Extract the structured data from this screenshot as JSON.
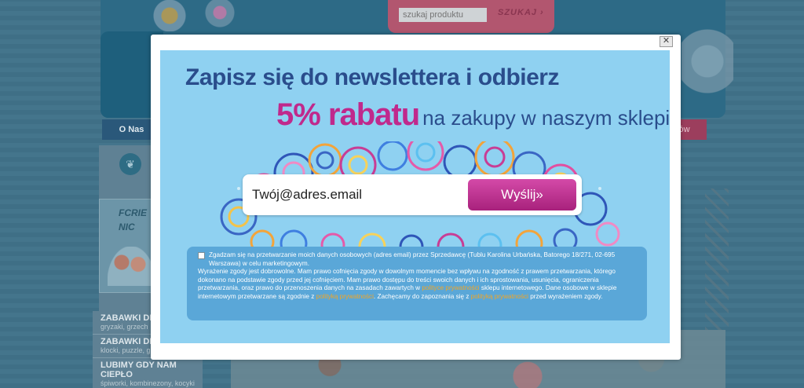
{
  "background": {
    "search": {
      "placeholder": "szukaj produktu",
      "button_label": "SZUKAJ ›"
    },
    "nav": {
      "left_label": "O Nas",
      "right_label": "ntów"
    },
    "promo": {
      "line1": "FCRIE",
      "line2": "NIC"
    },
    "categories": [
      {
        "title": "ZABAWKI DI",
        "sub": "gryzaki, grzech"
      },
      {
        "title": "ZABAWKI DI",
        "sub": "klocki, puzzle, gi"
      },
      {
        "title": "LUBIMY GDY NAM CIEPŁO",
        "sub": "śpiworki, kombinezony, kocyki"
      }
    ]
  },
  "modal": {
    "close_label": "✕",
    "headline": "Zapisz się do newslettera i odbierz",
    "discount": "5% rabatu",
    "discount_rest": "na zakupy w naszym sklepie",
    "email_placeholder": "Twój@adres.email",
    "send_label": "Wyślij»",
    "consent": {
      "p1": "Zgadzam się na przetwarzanie moich danych osobowych (adres email) przez Sprzedawcę (Tublu Karolina Urbańska, Batorego 18/271, 02-695 Warszawa) w celu marketingowym.",
      "p2_a": "Wyrażenie zgody jest dobrowolne. Mam prawo cofnięcia zgody w dowolnym momencie bez wpływu na zgodność z prawem przetwarzania, którego dokonano na podstawie zgody przed jej cofnięciem. Mam prawo dostępu do treści swoich danych i ich sprostowania, usunięcia, ograniczenia przetwarzania, oraz prawo do przenoszenia danych na zasadach zawartych w",
      "link1": "polityce prywatności",
      "p2_b": "sklepu internetowego. Dane osobowe w sklepie internetowym przetwarzane są zgodnie z",
      "link2": "polityką prywatności",
      "p2_c": ". Zachęcamy do zapoznania się z",
      "link3": "polityką prywatności",
      "p2_d": "przed wyrażeniem zgody."
    }
  },
  "colors": {
    "accent_pink": "#c0298c",
    "headline_blue": "#2a4d8c",
    "link_orange": "#f5a623"
  }
}
